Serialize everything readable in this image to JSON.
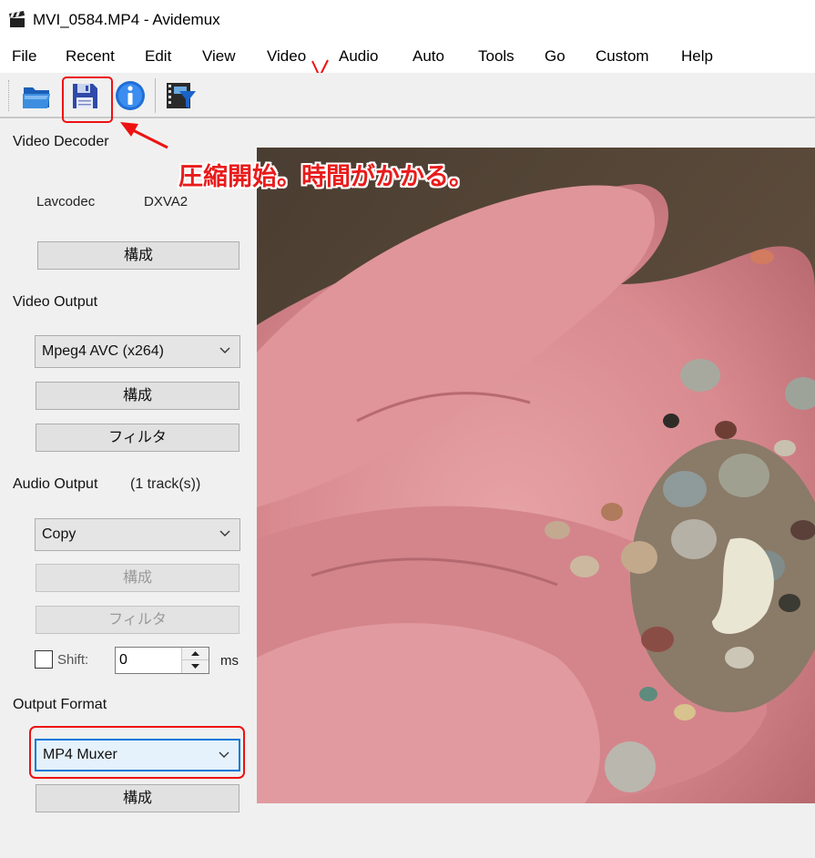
{
  "window": {
    "title": "MVI_0584.MP4 - Avidemux"
  },
  "menu": {
    "items": [
      "File",
      "Recent",
      "Edit",
      "View",
      "Video",
      "Audio",
      "Auto",
      "Tools",
      "Go",
      "Custom",
      "Help"
    ]
  },
  "toolbar": {
    "icons": [
      "open-folder-icon",
      "save-floppy-icon",
      "info-icon",
      "filter-icon"
    ]
  },
  "video_decoder": {
    "heading": "Video Decoder",
    "codec": "Lavcodec",
    "hw": "DXVA2",
    "configure_label": "構成"
  },
  "video_output": {
    "heading": "Video Output",
    "selected": "Mpeg4 AVC (x264)",
    "configure_label": "構成",
    "filter_label": "フィルタ"
  },
  "audio_output": {
    "heading": "Audio Output",
    "tracks": "(1 track(s))",
    "selected": "Copy",
    "configure_label": "構成",
    "filter_label": "フィルタ",
    "shift_label": "Shift:",
    "shift_value": "0",
    "shift_unit": "ms"
  },
  "output_format": {
    "heading": "Output Format",
    "selected": "MP4 Muxer",
    "configure_label": "構成"
  },
  "annotation": {
    "text": "圧縮開始。時間がかかる。",
    "color": "#e81c1c"
  }
}
